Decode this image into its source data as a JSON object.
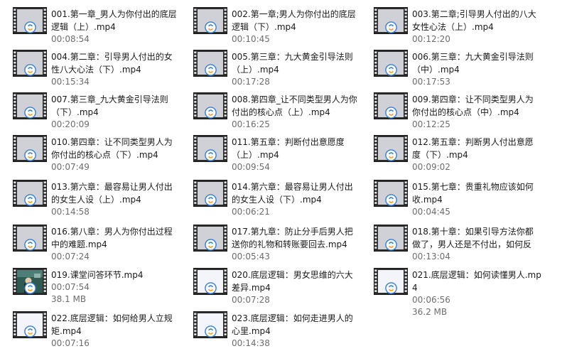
{
  "files": [
    {
      "name": "001.第一章_男人为你付出的底层逻辑（上）.mp4",
      "duration": "00:08:54",
      "thumb": "video-icon"
    },
    {
      "name": "002.第一章;男人为你付出的底层逻辑（下）.mp4",
      "duration": "00:10:45",
      "thumb": "video-icon"
    },
    {
      "name": "003.第二章;引导男人付出的八大女性心法（上）.mp4",
      "duration": "00:12:20",
      "thumb": "video-icon"
    },
    {
      "name": "004.第二章：引导男人付出的女性八大心法（下）.mp4",
      "duration": "00:15:34",
      "thumb": "video-icon"
    },
    {
      "name": "005.第三章：九大黄金引导法则（上）.mp4",
      "duration": "00:17:28",
      "thumb": "video-icon"
    },
    {
      "name": "006.第三章：九大黄金引导法则（中）.mp4",
      "duration": "00:17:53",
      "thumb": "video-icon"
    },
    {
      "name": "007.第三章_九大黄金引导法则（下）.mp4",
      "duration": "00:20:09",
      "thumb": "video-icon"
    },
    {
      "name": "008.第四章_让不同类型男人为你付出的核心点（上）.mp4",
      "duration": "00:16:25",
      "thumb": "video-icon"
    },
    {
      "name": "009.第四章：让不同类型男人为你付出的核心点（中）.mp4",
      "duration": "00:12:25",
      "thumb": "video-icon"
    },
    {
      "name": "010.第四章：让不同类型男人为你付出的核心点（下）.mp4",
      "duration": "00:07:49",
      "thumb": "video-icon"
    },
    {
      "name": "011.第五章：判断付出意愿度（上）.mp4",
      "duration": "00:09:54",
      "thumb": "video-icon"
    },
    {
      "name": "012.第五章：判断男人付出意愿度（下）.mp4",
      "duration": "00:09:02",
      "thumb": "video-icon"
    },
    {
      "name": "013.第六章：最容易让男人付出的女生人设（上）.mp4",
      "duration": "00:14:58",
      "thumb": "video-icon"
    },
    {
      "name": "014.第六章：最容易让男人付出的女生人设（下）.mp4",
      "duration": "00:06:21",
      "thumb": "video-icon"
    },
    {
      "name": "015.第七章：贵重礼物应该如何收.mp4",
      "duration": "00:04:45",
      "thumb": "video-icon"
    },
    {
      "name": "016.第八章：男人为你付出过程中的难题.mp4",
      "duration": "00:07:24",
      "thumb": "video-icon"
    },
    {
      "name": "017.第九章：防止分手后男人把送你的礼物和转账要回去.mp4",
      "duration": "00:05:43",
      "thumb": "video-icon"
    },
    {
      "name": "018.第十章：如果引导方法你都做了，男人还是不付出，如何反馈...",
      "duration": "00:13:04",
      "thumb": "video-icon"
    },
    {
      "name": "019.课堂问答环节.mp4",
      "duration": "00:07:54",
      "size": "38.1 MB",
      "thumb": "video-preview"
    },
    {
      "name": "020.底层逻辑：男女思维的六大差异.mp4",
      "duration": "00:07:28",
      "thumb": "video-blank"
    },
    {
      "name": "021.底层逻辑：如何读懂男人.mp4",
      "duration": "00:06:56",
      "size": "36.2 MB",
      "thumb": "video-blank"
    },
    {
      "name": "022.底层逻辑：如何给男人立规矩.mp4",
      "duration": "00:07:16",
      "thumb": "video-blank"
    },
    {
      "name": "023.底层逻辑：如何走进男人的心里.mp4",
      "duration": "00:14:38",
      "thumb": "video-blank"
    }
  ]
}
